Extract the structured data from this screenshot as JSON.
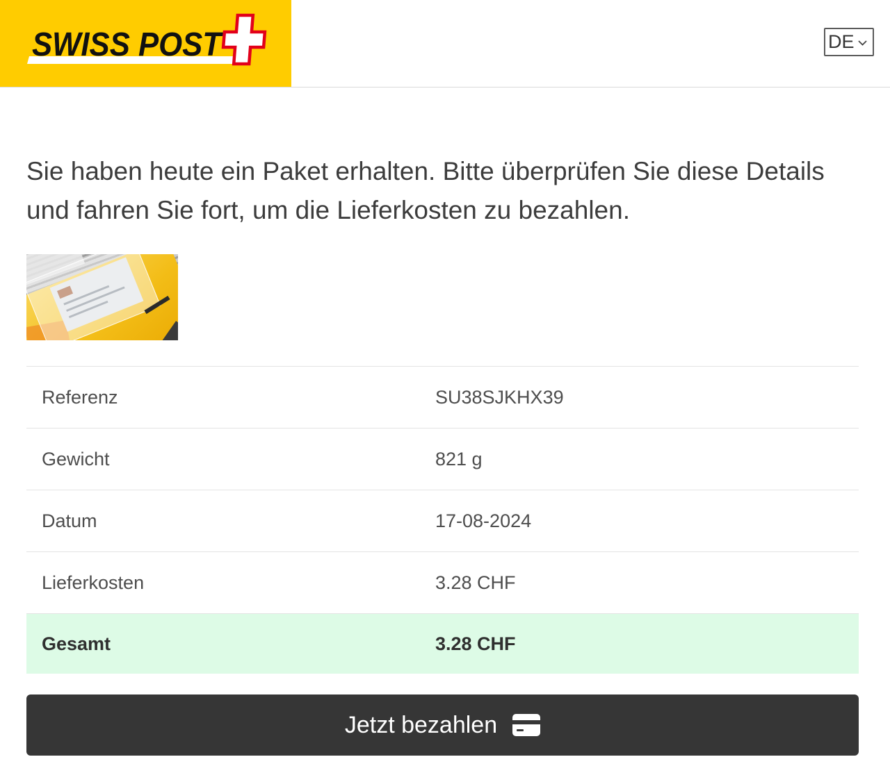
{
  "header": {
    "logo": {
      "text": "SWISS POST",
      "cross_icon": "swiss-cross-icon"
    },
    "language_select": {
      "value": "DE",
      "icon": "chevron-down-icon"
    }
  },
  "main": {
    "message": "Sie haben heute ein Paket erhalten. Bitte überprüfen Sie diese Details und fahren Sie fort, um die Lieferkosten zu bezahlen.",
    "details": [
      {
        "label": "Referenz",
        "value": "SU38SJKHX39"
      },
      {
        "label": "Gewicht",
        "value": "821 g"
      },
      {
        "label": "Datum",
        "value": "17-08-2024"
      },
      {
        "label": "Lieferkosten",
        "value": "3.28 CHF"
      }
    ],
    "total": {
      "label": "Gesamt",
      "value": "3.28 CHF"
    },
    "pay_button": {
      "label": "Jetzt bezahlen",
      "icon": "credit-card-icon"
    }
  },
  "colors": {
    "brand_yellow": "#FFCC00",
    "brand_red": "#E2001A",
    "total_row_bg": "#DDFBE6",
    "button_bg": "#363636"
  }
}
